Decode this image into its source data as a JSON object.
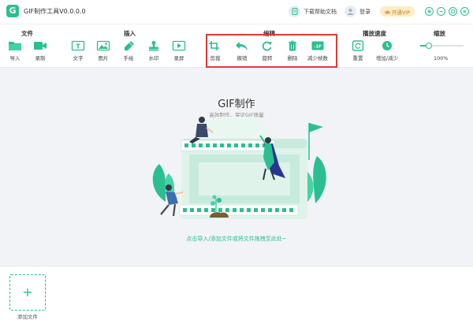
{
  "titlebar": {
    "app_title": "GIF制作工具V0.0.0.0",
    "logo_letter": "G",
    "help": "下载帮助文档",
    "login": "登录",
    "vip": "开通VIP"
  },
  "toolbar": {
    "groups": {
      "file": "文件",
      "insert": "插入",
      "edit": "编辑",
      "speed": "播放速度",
      "zoom": "缩放"
    },
    "tools": {
      "import": "导入",
      "record": "录制",
      "text": "文字",
      "image": "图片",
      "draw": "手绘",
      "watermark": "水印",
      "screen_record": "录屏",
      "crop": "剪裁",
      "undo": "撤销",
      "rotate": "旋转",
      "delete": "删除",
      "reduce_frames": "减少帧数",
      "reset": "重置",
      "speed_adjust": "增加/减少"
    },
    "zoom_value": "100%",
    "zoom_level": 0.2
  },
  "main": {
    "title": "GIF制作",
    "subtitle": "高效制作，保证GIF质量",
    "drop_hint": "点击导入/添加文件或将文件拖拽至此处~"
  },
  "bottom": {
    "add_file": "添加文件"
  },
  "colors": {
    "accent": "#2bbf8f",
    "highlight": "#e53935"
  }
}
